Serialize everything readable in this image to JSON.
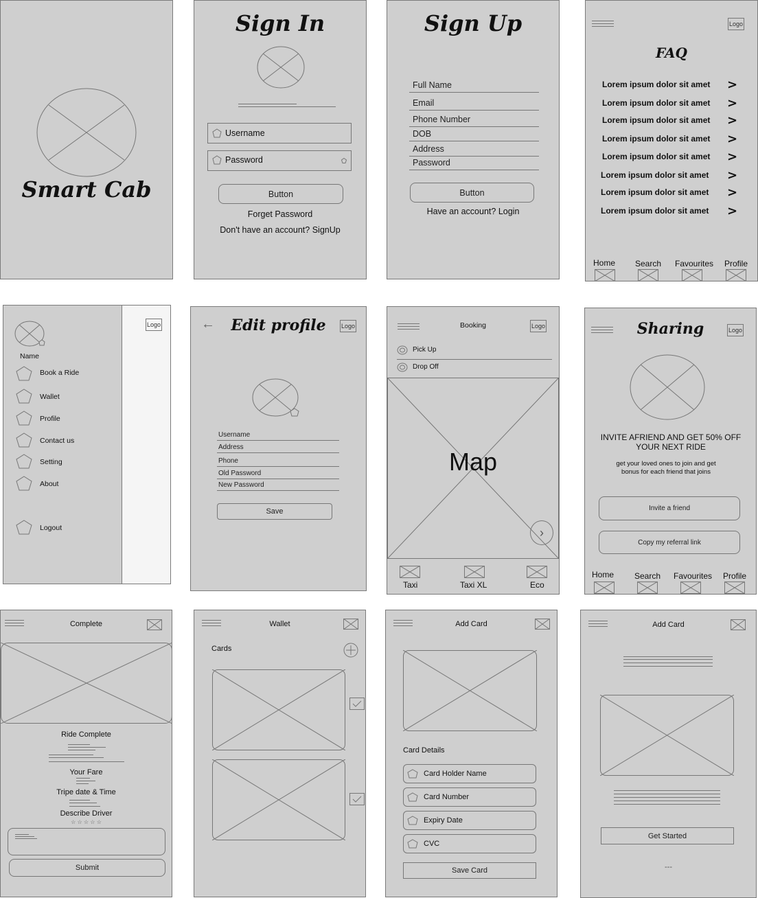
{
  "splash": {
    "title": "Smart Cab"
  },
  "signin": {
    "title": "Sign In",
    "username_placeholder": "Username",
    "password_placeholder": "Password",
    "button": "Button",
    "forget": "Forget Password",
    "signup_link": "Don't have an account? SignUp"
  },
  "signup": {
    "title": "Sign Up",
    "fields": [
      "Full Name",
      "Email",
      "Phone Number",
      "DOB",
      "Address",
      "Password"
    ],
    "button": "Button",
    "login_link": "Have an account? Login"
  },
  "faq": {
    "title": "FAQ",
    "logo": "Logo",
    "items": [
      "Lorem ipsum dolor sit amet",
      "Lorem ipsum dolor sit amet",
      "Lorem ipsum dolor sit amet",
      "Lorem ipsum dolor sit amet",
      "Lorem ipsum dolor sit amet",
      "Lorem ipsum dolor sit amet",
      "Lorem ipsum dolor sit amet",
      "Lorem ipsum dolor sit amet"
    ],
    "chevron": ">",
    "nav": [
      "Home",
      "Search",
      "Favourites",
      "Profile"
    ]
  },
  "drawer": {
    "logo": "Logo",
    "name": "Name",
    "items": [
      "Book a Ride",
      "Wallet",
      "Profile",
      "Contact us",
      "Setting",
      "About"
    ],
    "logout": "Logout"
  },
  "edit_profile": {
    "title": "Edit profile",
    "logo": "Logo",
    "back": "←",
    "fields": [
      "Username",
      "Address",
      "Phone",
      "Old Password",
      "New Password"
    ],
    "save": "Save"
  },
  "booking": {
    "title": "Booking",
    "logo": "Logo",
    "pickup": "Pick Up",
    "dropoff": "Drop Off",
    "map": "Map",
    "go": "›",
    "rides": [
      "Taxi",
      "Taxi XL",
      "Eco"
    ]
  },
  "sharing": {
    "title": "Sharing",
    "logo": "Logo",
    "headline": "INVITE AFRIEND AND GET 50% OFF YOUR NEXT RIDE",
    "sub": "get your loved ones to join and get bonus for each friend that joins",
    "invite": "Invite a friend",
    "copy": "Copy my referral link",
    "nav": [
      "Home",
      "Search",
      "Favourites",
      "Profile"
    ]
  },
  "complete": {
    "title": "Complete",
    "ride_complete": "Ride Complete",
    "fare": "Your Fare",
    "datetime": "Tripe date & Time",
    "describe": "Describe Driver",
    "stars": "☆ ☆ ☆ ☆ ☆",
    "submit": "Submit"
  },
  "wallet": {
    "title": "Wallet",
    "cards": "Cards"
  },
  "addcard1": {
    "title": "Add Card",
    "details": "Card Details",
    "fields": [
      "Card Holder Name",
      "Card Number",
      "Expiry Date",
      "CVC"
    ],
    "save": "Save Card"
  },
  "addcard2": {
    "title": "Add Card",
    "start": "Get Started",
    "dots": "---"
  }
}
